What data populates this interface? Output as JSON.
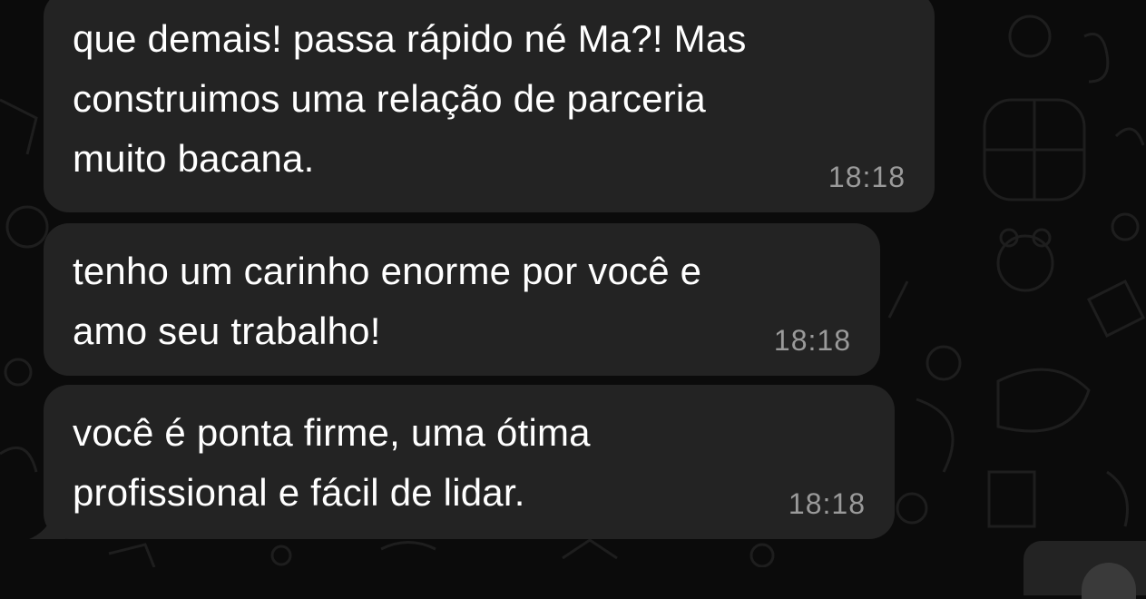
{
  "chat": {
    "messages": [
      {
        "text": "que demais! passa rápido né Ma?! Mas\nconstruimos uma relação de parceria\nmuito bacana.",
        "time": "18:18"
      },
      {
        "text": "tenho um carinho enorme por você e\namo seu trabalho!",
        "time": "18:18"
      },
      {
        "text": "você é ponta firme, uma ótima\nprofissional e fácil de lidar.",
        "time": "18:18"
      }
    ]
  },
  "colors": {
    "background": "#0b0b0b",
    "bubble": "#232323",
    "text": "#ffffff",
    "timestamp": "#9a9a9a"
  }
}
